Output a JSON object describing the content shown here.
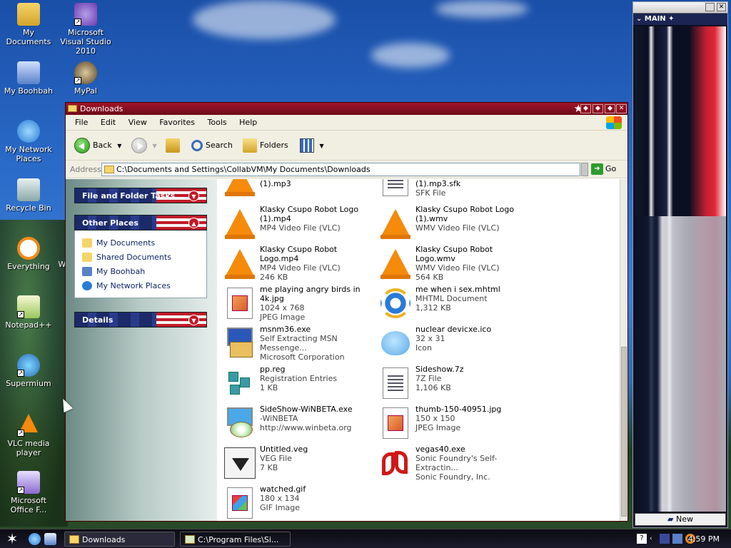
{
  "desktop": {
    "icons": [
      {
        "label": "My Documents",
        "icon": "my-documents-icon"
      },
      {
        "label": "Microsoft Visual Studio 2010",
        "icon": "visual-studio-icon"
      },
      {
        "label": "My Boohbah",
        "icon": "my-computer-icon"
      },
      {
        "label": "MyPal",
        "icon": "mypal-browser-icon"
      },
      {
        "label": "My Network Places",
        "icon": "network-places-icon"
      },
      {
        "label": "Recycle Bin",
        "icon": "recycle-bin-icon"
      },
      {
        "label": "Everything",
        "icon": "everything-search-icon"
      },
      {
        "label": "Notepad++",
        "icon": "notepadpp-icon"
      },
      {
        "label": "Supermium",
        "icon": "supermium-icon"
      },
      {
        "label": "VLC media player",
        "icon": "vlc-icon"
      },
      {
        "label": "Microsoft Office F...",
        "icon": "office-icon"
      }
    ],
    "partial_label": "W"
  },
  "widget": {
    "title": "MAIN",
    "new_button": "New"
  },
  "window": {
    "title": "Downloads",
    "menu": [
      "File",
      "Edit",
      "View",
      "Favorites",
      "Tools",
      "Help"
    ],
    "toolbar": {
      "back": "Back",
      "search": "Search",
      "folders": "Folders"
    },
    "address": {
      "label": "Address",
      "value": "C:\\Documents and Settings\\CollabVM\\My Documents\\Downloads",
      "go": "Go"
    },
    "taskpane": {
      "file_tasks": "File and Folder Tasks",
      "other_places": "Other Places",
      "other_links": [
        "My Documents",
        "Shared Documents",
        "My Boohbah",
        "My Network Places"
      ],
      "details": "Details"
    },
    "files": [
      {
        "name": "(1).mp3",
        "line2": "",
        "line3": "",
        "icon": "vlc-file-icon"
      },
      {
        "name": "(1).mp3.sfk",
        "line2": "SFK File",
        "line3": "",
        "icon": "generic-file-icon"
      },
      {
        "name": "Klasky Csupo Robot Logo",
        "line2": "(1).mp4",
        "line3": "MP4 Video File (VLC)",
        "icon": "vlc-file-icon"
      },
      {
        "name": "Klasky Csupo Robot Logo",
        "line2": "(1).wmv",
        "line3": "WMV Video File (VLC)",
        "icon": "vlc-file-icon"
      },
      {
        "name": "Klasky Csupo Robot Logo.mp4",
        "line2": "MP4 Video File (VLC)",
        "line3": "246 KB",
        "icon": "vlc-file-icon"
      },
      {
        "name": "Klasky Csupo Robot Logo.wmv",
        "line2": "WMV Video File (VLC)",
        "line3": "564 KB",
        "icon": "vlc-file-icon"
      },
      {
        "name": "me playing angry birds in 4k.jpg",
        "line2": "1024 x 768",
        "line3": "JPEG Image",
        "icon": "jpeg-file-icon"
      },
      {
        "name": "me when i sex.mhtml",
        "line2": "MHTML Document",
        "line3": "1,312 KB",
        "icon": "ie-document-icon"
      },
      {
        "name": "msnm36.exe",
        "line2": "Self Extracting MSN Messenge...",
        "line3": "Microsoft Corporation",
        "icon": "installer-icon"
      },
      {
        "name": "nuclear devicxe.ico",
        "line2": "32 x 31",
        "line3": "Icon",
        "icon": "bird-icon"
      },
      {
        "name": "pp.reg",
        "line2": "Registration Entries",
        "line3": "1 KB",
        "icon": "registry-file-icon"
      },
      {
        "name": "Sideshow.7z",
        "line2": "7Z File",
        "line3": "1,106 KB",
        "icon": "generic-file-icon"
      },
      {
        "name": "SideShow-WiNBETA.exe",
        "line2": "-WiNBETA",
        "line3": "http://www.winbeta.org",
        "icon": "setup-cd-icon"
      },
      {
        "name": "thumb-150-40951.jpg",
        "line2": "150 x 150",
        "line3": "JPEG Image",
        "icon": "jpeg-file-icon"
      },
      {
        "name": "Untitled.veg",
        "line2": "VEG File",
        "line3": "7 KB",
        "icon": "veg-file-icon"
      },
      {
        "name": "vegas40.exe",
        "line2": "Sonic Foundry's Self-Extractin...",
        "line3": "Sonic Foundry, Inc.",
        "icon": "sonic-foundry-icon"
      },
      {
        "name": "watched.gif",
        "line2": "180 x 134",
        "line3": "GIF Image",
        "icon": "gif-file-icon"
      }
    ]
  },
  "taskbar": {
    "tasks": [
      "Downloads",
      "C:\\Program Files\\Si..."
    ],
    "clock": "4:59 PM"
  },
  "colors": {
    "title_red": "#a0152a",
    "navy": "#1c2a6a",
    "link_blue": "#0a246a"
  }
}
